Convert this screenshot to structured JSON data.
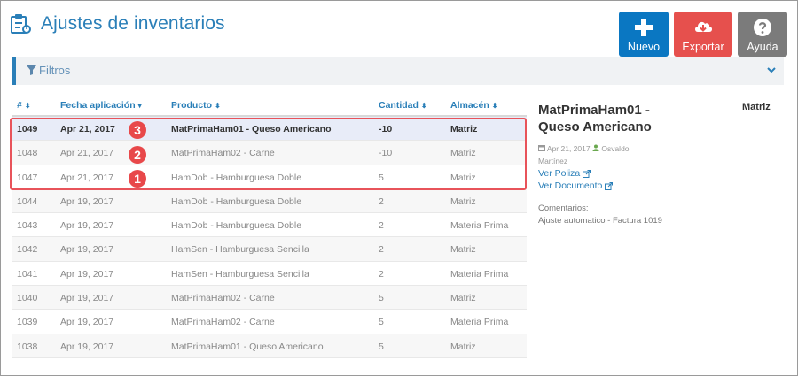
{
  "header": {
    "title": "Ajustes de inventarios",
    "buttons": {
      "new": "Nuevo",
      "export": "Exportar",
      "help": "Ayuda"
    }
  },
  "filters": {
    "label": "Filtros"
  },
  "table": {
    "columns": {
      "id": "#",
      "date": "Fecha aplicación",
      "product": "Producto",
      "quantity": "Cantidad",
      "warehouse": "Almacén"
    },
    "rows": [
      {
        "id": "1049",
        "date": "Apr 21, 2017",
        "product": "MatPrimaHam01 - Queso Americano",
        "quantity": "-10",
        "warehouse": "Matriz"
      },
      {
        "id": "1048",
        "date": "Apr 21, 2017",
        "product": "MatPrimaHam02 - Carne",
        "quantity": "-10",
        "warehouse": "Matriz"
      },
      {
        "id": "1047",
        "date": "Apr 21, 2017",
        "product": "HamDob - Hamburguesa Doble",
        "quantity": "5",
        "warehouse": "Matriz"
      },
      {
        "id": "1044",
        "date": "Apr 19, 2017",
        "product": "HamDob - Hamburguesa Doble",
        "quantity": "2",
        "warehouse": "Matriz"
      },
      {
        "id": "1043",
        "date": "Apr 19, 2017",
        "product": "HamDob - Hamburguesa Doble",
        "quantity": "2",
        "warehouse": "Materia Prima"
      },
      {
        "id": "1042",
        "date": "Apr 19, 2017",
        "product": "HamSen - Hamburguesa Sencilla",
        "quantity": "2",
        "warehouse": "Matriz"
      },
      {
        "id": "1041",
        "date": "Apr 19, 2017",
        "product": "HamSen - Hamburguesa Sencilla",
        "quantity": "2",
        "warehouse": "Materia Prima"
      },
      {
        "id": "1040",
        "date": "Apr 19, 2017",
        "product": "MatPrimaHam02 - Carne",
        "quantity": "5",
        "warehouse": "Matriz"
      },
      {
        "id": "1039",
        "date": "Apr 19, 2017",
        "product": "MatPrimaHam02 - Carne",
        "quantity": "5",
        "warehouse": "Materia Prima"
      },
      {
        "id": "1038",
        "date": "Apr 19, 2017",
        "product": "MatPrimaHam01 - Queso Americano",
        "quantity": "5",
        "warehouse": "Matriz"
      }
    ]
  },
  "markers": [
    "3",
    "2",
    "1"
  ],
  "detail": {
    "title": "MatPrimaHam01 - Queso Americano",
    "warehouse": "Matriz",
    "date": "Apr 21, 2017",
    "user": "Osvaldo Martínez",
    "link_poliza": "Ver Poliza",
    "link_documento": "Ver Documento",
    "comments_label": "Comentarios:",
    "comments_text": "Ajuste automatico - Factura 1019"
  },
  "colors": {
    "accent": "#2a7fb8",
    "new": "#0a77c2",
    "export": "#e6504d",
    "help": "#7b7b7b",
    "highlight": "#e8535a"
  }
}
